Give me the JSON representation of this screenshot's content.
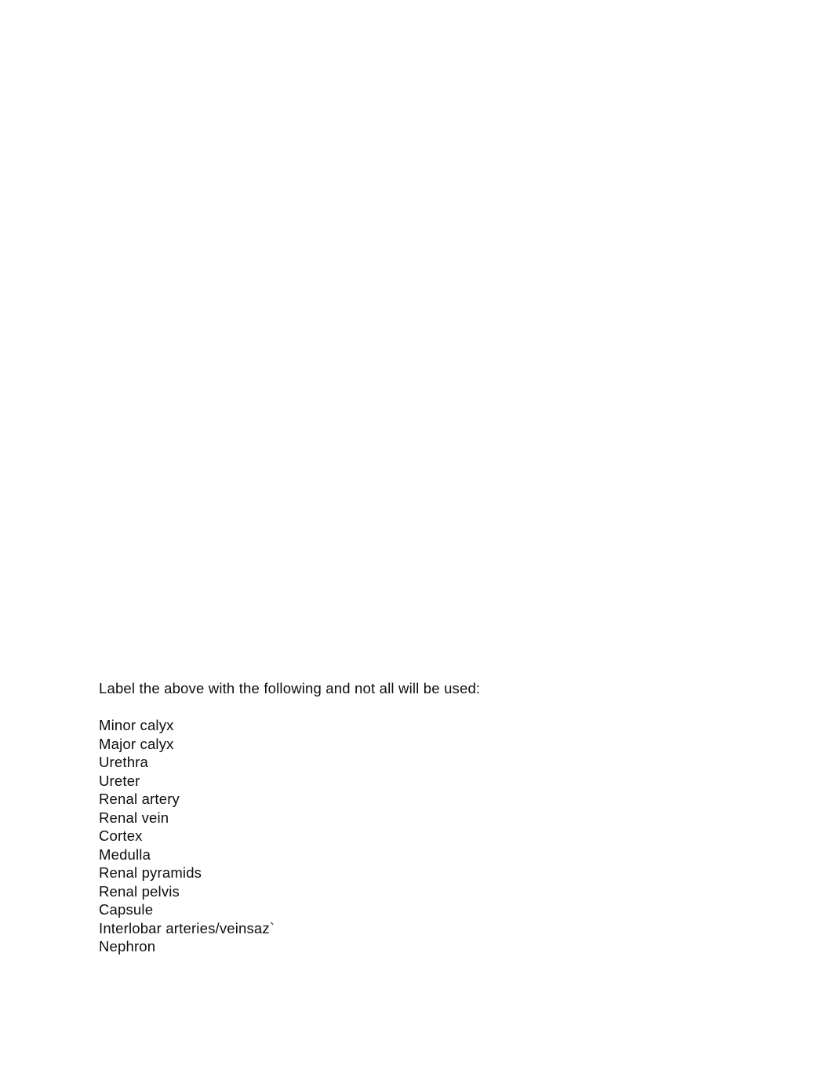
{
  "document": {
    "page_background": "#ffffff",
    "text_color": "#0d0d0d",
    "body": {
      "instruction": "Label the above with the following and not all will be used:",
      "label_options": [
        "Minor calyx",
        "Major calyx",
        "Urethra",
        "Ureter",
        "Renal artery",
        "Renal vein",
        "Cortex",
        "Medulla",
        "Renal pyramids",
        "Renal pelvis",
        "Capsule",
        "Interlobar arteries/veinsaz`",
        "Nephron"
      ]
    }
  }
}
